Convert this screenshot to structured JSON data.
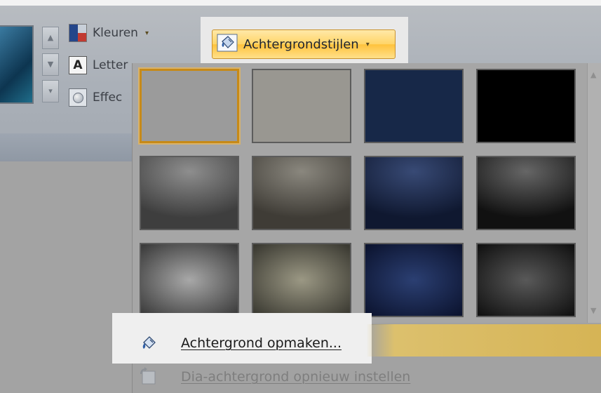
{
  "ribbon": {
    "themes_group": {
      "commands": [
        {
          "label": "Kleuren",
          "icon": "colors-icon",
          "has_dropdown": true
        },
        {
          "label": "Letter",
          "icon": "letter-icon"
        },
        {
          "label": "Effec",
          "icon": "effects-icon"
        }
      ],
      "scroll_up": "▲",
      "scroll_down": "▼",
      "scroll_more": "▾"
    },
    "background_group": {
      "button_label": "Achtergrondstijlen",
      "button_icon": "paint-bucket-icon",
      "dropdown_caret": "▾"
    }
  },
  "gallery": {
    "scroll_up": "▲",
    "scroll_down": "▼",
    "styles": [
      {
        "row": 1,
        "col": 1,
        "fill": "#9b9b9b",
        "style": "flat",
        "selected": true
      },
      {
        "row": 1,
        "col": 2,
        "fill": "#999791",
        "style": "flat"
      },
      {
        "row": 1,
        "col": 3,
        "fill": "#172848",
        "style": "flat"
      },
      {
        "row": 1,
        "col": 4,
        "fill": "#000000",
        "style": "flat"
      },
      {
        "row": 2,
        "col": 1,
        "fill": "#8e8e8e",
        "edge": "#3e3e3e",
        "style": "top-glow"
      },
      {
        "row": 2,
        "col": 2,
        "fill": "#8a877e",
        "edge": "#3f3c36",
        "style": "top-glow"
      },
      {
        "row": 2,
        "col": 3,
        "fill": "#384a75",
        "edge": "#0f1830",
        "style": "top-glow"
      },
      {
        "row": 2,
        "col": 4,
        "fill": "#666666",
        "edge": "#111111",
        "style": "top-glow"
      },
      {
        "row": 3,
        "col": 1,
        "fill": "#a8a8a8",
        "edge": "#3c3c3c",
        "style": "center-glow"
      },
      {
        "row": 3,
        "col": 2,
        "fill": "#9b9884",
        "edge": "#3b3a32",
        "style": "center-glow"
      },
      {
        "row": 3,
        "col": 3,
        "fill": "#2b3f72",
        "edge": "#0c1430",
        "style": "center-glow"
      },
      {
        "row": 3,
        "col": 4,
        "fill": "#595959",
        "edge": "#121212",
        "style": "center-glow"
      }
    ]
  },
  "menu": {
    "format_background": {
      "label": "Achtergrond opmaken...",
      "icon": "format-background-icon",
      "enabled": true
    },
    "reset_background": {
      "label": "Dia-achtergrond opnieuw instellen",
      "icon": "reset-background-icon",
      "enabled": false
    }
  }
}
